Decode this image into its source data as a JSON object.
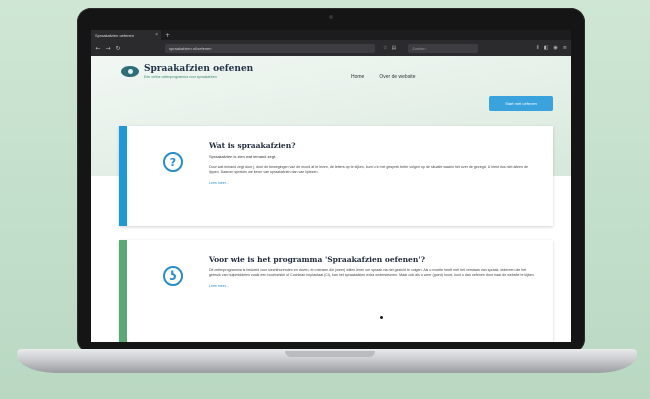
{
  "colors": {
    "background": "#c5e1cc",
    "accent_blue": "#3aa3dd",
    "card1_bar": "#1d9ad6",
    "card2_bar": "#5aa873",
    "logo": "#2e6e78"
  },
  "browser": {
    "tab_label": "Spraakafzien oefenen",
    "tab_close": "×",
    "new_tab": "+",
    "back": "←",
    "forward": "→",
    "reload": "↻",
    "url": "spraakafzien.nl/oefenen",
    "search_placeholder": "Zoeken",
    "icons": [
      "star-icon",
      "library-icon",
      "extensions-icon",
      "menu-icon"
    ]
  },
  "site": {
    "title": "Spraakafzien oefenen",
    "subtitle": "Een online oefenprogramma voor spraakafzien",
    "nav": [
      "Home",
      "Over de website"
    ],
    "cta_label": "Start met oefenen"
  },
  "cards": [
    {
      "icon_glyph": "?",
      "icon_name": "question-icon",
      "title": "Wat is spraakafzien?",
      "lead": "Spraakafzien is zien wat iemand zegt.",
      "text": "Door wat iemand zegt door j, door de bewegingen van de mond af te lezen, de letters op te kijken, kunt u in het gesprek beter volgen op de situatie waarin het over de gezegd. U leest dus niet alleen de lippen. Daarom spreken we liever van spraakafzien dan van liplezen.",
      "link": "Lees meer..."
    },
    {
      "icon_glyph": "ʖ",
      "icon_name": "ear-icon",
      "title": "Voor wie is het programma 'Spraakafzien oefenen'?",
      "lead": "",
      "text": "Dit oefenprogramma is bedoeld voor slechthorenden en doven, en mensen die (weer) willen leren om spraak via het gezicht te volgen. Als u moeite heeft met het verstaan van spraak, iedereen die het gebruik van hulpmiddelen zoals een hoortoestel of Cochleair Implantaat (CI), kan het spraakafzien extra ondersteunen. Maar ook als u weer (goed) hoort, kunt u dan oefenen door naar de website te kijken.",
      "link": "Lees meer..."
    }
  ]
}
